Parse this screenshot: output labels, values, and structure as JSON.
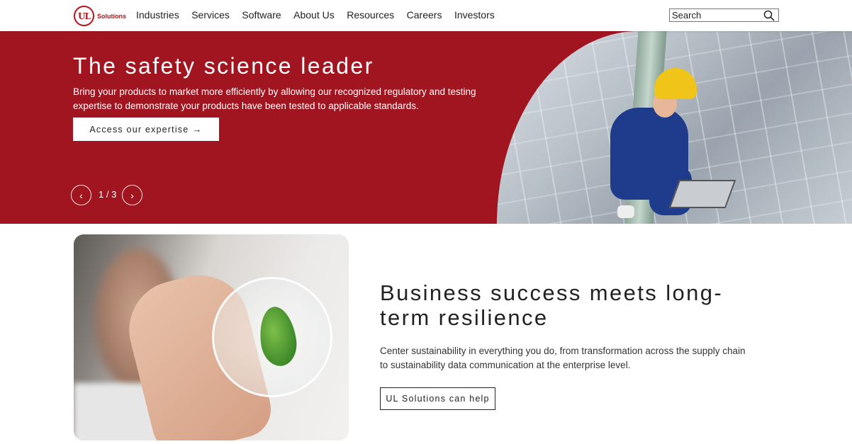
{
  "header": {
    "logo": {
      "mark": "UL",
      "text": "Solutions"
    },
    "nav": [
      "Industries",
      "Services",
      "Software",
      "About Us",
      "Resources",
      "Careers",
      "Investors"
    ],
    "search": {
      "placeholder": "Search",
      "icon": "search-icon"
    }
  },
  "hero": {
    "title": "The safety science leader",
    "description": "Bring your products to market more efficiently by allowing our recognized regulatory and testing expertise to demonstrate your products have been tested to applicable standards.",
    "button_label": "Access our expertise",
    "button_arrow": "→",
    "prev_icon": "‹",
    "next_icon": "›",
    "slide_counter": "1 / 3",
    "background_color": "#a11520"
  },
  "feature": {
    "title": "Business success meets long-term resilience",
    "description": "Center sustainability in everything you do, from transformation across the supply chain to sustainability data communication at the enterprise level.",
    "button_label": "UL Solutions can help"
  }
}
